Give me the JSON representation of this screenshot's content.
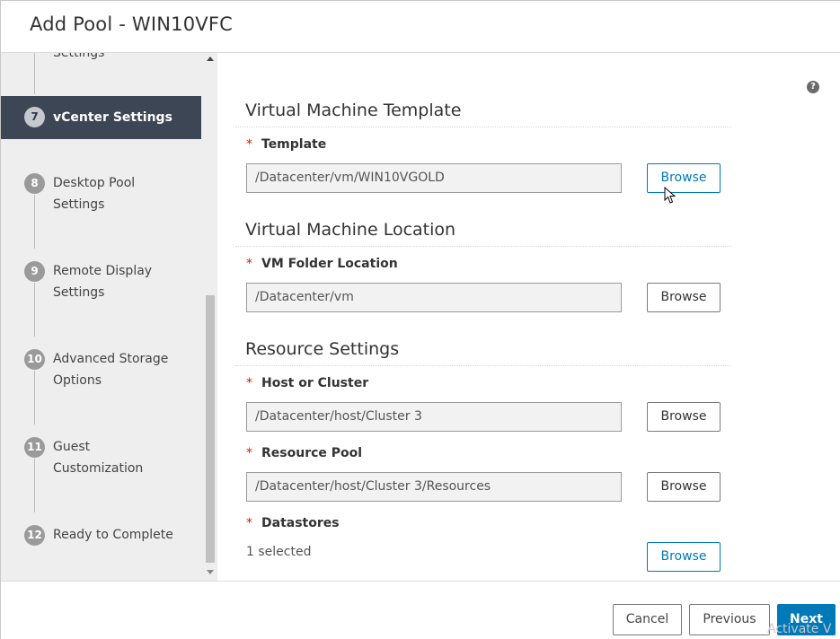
{
  "window": {
    "title": "Add Pool - WIN10VFC"
  },
  "sidebar": {
    "partial_item": "Settings",
    "steps": [
      {
        "num": "7",
        "line1": "vCenter Settings",
        "line2": "",
        "active": true
      },
      {
        "num": "8",
        "line1": "Desktop Pool",
        "line2": "Settings",
        "active": false
      },
      {
        "num": "9",
        "line1": "Remote Display",
        "line2": "Settings",
        "active": false
      },
      {
        "num": "10",
        "line1": "Advanced Storage",
        "line2": "Options",
        "active": false
      },
      {
        "num": "11",
        "line1": "Guest",
        "line2": "Customization",
        "active": false
      },
      {
        "num": "12",
        "line1": "Ready to Complete",
        "line2": "",
        "active": false
      }
    ]
  },
  "main": {
    "help_icon": "?",
    "sections": {
      "vm_template": {
        "title": "Virtual Machine Template",
        "template_label": "Template",
        "template_value": "/Datacenter/vm/WIN10VGOLD",
        "browse": "Browse"
      },
      "vm_location": {
        "title": "Virtual Machine Location",
        "folder_label": "VM Folder Location",
        "folder_value": "/Datacenter/vm",
        "browse": "Browse"
      },
      "resource": {
        "title": "Resource Settings",
        "host_label": "Host or Cluster",
        "host_value": "/Datacenter/host/Cluster 3",
        "host_browse": "Browse",
        "pool_label": "Resource Pool",
        "pool_value": "/Datacenter/host/Cluster 3/Resources",
        "pool_browse": "Browse",
        "datastores_label": "Datastores",
        "datastores_value": "1 selected",
        "datastores_browse": "Browse"
      }
    },
    "required_marker": "*"
  },
  "footer": {
    "cancel": "Cancel",
    "previous": "Previous",
    "next": "Next"
  },
  "watermark": "Activate V",
  "colors": {
    "primary": "#0079b8",
    "active_step_bg": "#3d4654",
    "required": "#c92100"
  }
}
